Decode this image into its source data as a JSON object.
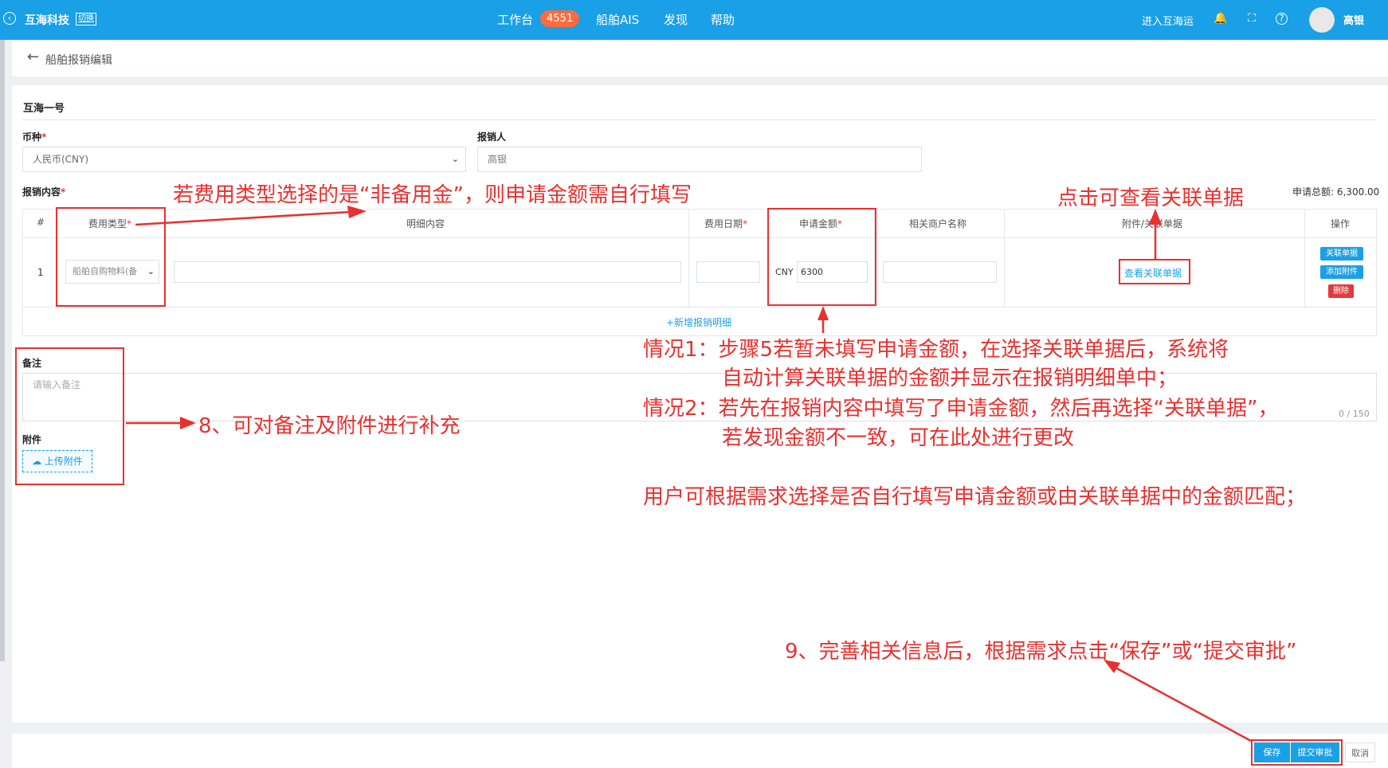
{
  "topbar": {
    "brand": "互海科技",
    "switch_label": "切换",
    "nav": [
      "工作台",
      "船舶AIS",
      "发现",
      "帮助"
    ],
    "workbench_badge": "4551",
    "enter_label": "进入互海运",
    "user_name": "高银"
  },
  "page": {
    "title": "船舶报销编辑"
  },
  "form": {
    "ship_name": "互海一号",
    "currency_label": "币种",
    "currency_value": "人民币(CNY)",
    "reimburser_label": "报销人",
    "reimburser_value": "高银",
    "content_label": "报销内容",
    "total_label": "申请总额: 6,300.00",
    "remark_label": "备注",
    "remark_placeholder": "请输入备注",
    "remark_counter": "0 / 150",
    "attach_label": "附件",
    "upload_label": "上传附件"
  },
  "table": {
    "headers": [
      "#",
      "费用类型",
      "明细内容",
      "费用日期",
      "申请金额",
      "相关商户名称",
      "附件/关联单据",
      "操作"
    ],
    "rows": [
      {
        "index": "1",
        "fee_type": "船舶自购物料(备",
        "detail": "",
        "date": "",
        "currency": "CNY",
        "amount": "6300",
        "merchant": "",
        "related_link": "查看关联单据",
        "actions": [
          "关联单据",
          "添加附件",
          "删除"
        ]
      }
    ],
    "add_row_label": "+新增报销明细"
  },
  "footer": {
    "save": "保存",
    "submit": "提交审批",
    "cancel": "取消"
  },
  "annotations": {
    "fee_type_note": "若费用类型选择的是“非备用金”，则申请金额需自行填写",
    "view_related_note": "点击可查看关联单据",
    "case1_line1": "情况1：步骤5若暂未填写申请金额，在选择关联单据后，系统将",
    "case1_line2": "自动计算关联单据的金额并显示在报销明细单中；",
    "case2_line1": "情况2：若先在报销内容中填写了申请金额，然后再选择“关联单据”，",
    "case2_line2": "若发现金额不一致，可在此处进行更改",
    "user_note": "用户可根据需求选择是否自行填写申请金额或由关联单据中的金额匹配；",
    "step8": "8、可对备注及附件进行补充",
    "step9": "9、完善相关信息后，根据需求点击“保存”或“提交审批”"
  },
  "colors": {
    "topbar": "#1aa0e6",
    "annotation": "#e8312f",
    "badge": "#ff6b3d",
    "danger": "#e4393c"
  }
}
